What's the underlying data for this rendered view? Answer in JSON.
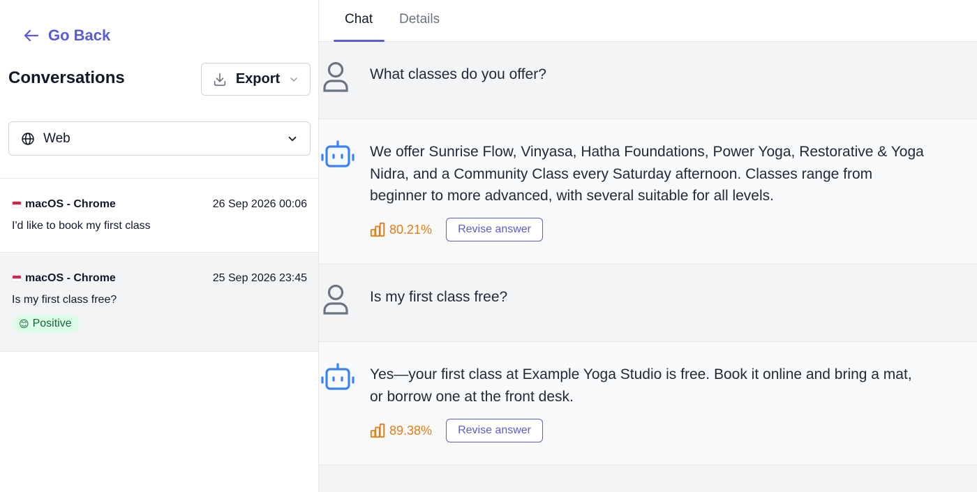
{
  "sidebar": {
    "go_back_label": "Go Back",
    "title": "Conversations",
    "export_label": "Export",
    "channel_filter": {
      "icon": "globe-icon",
      "selected": "Web"
    },
    "conversations": [
      {
        "device": "macOS - Chrome",
        "timestamp": "26 Sep 2026 00:06",
        "preview": "I'd like to book my first class"
      },
      {
        "device": "macOS - Chrome",
        "timestamp": "25 Sep 2026 23:45",
        "preview": "Is my first class free?",
        "sentiment": {
          "emoji": "😊",
          "label": "Positive"
        }
      }
    ]
  },
  "tabs": [
    {
      "label": "Chat",
      "active": true
    },
    {
      "label": "Details",
      "active": false
    }
  ],
  "messages": [
    {
      "role": "user",
      "text": "What classes do you offer?"
    },
    {
      "role": "bot",
      "text": "We offer Sunrise Flow, Vinyasa, Hatha Foundations, Power Yoga, Restorative & Yoga Nidra, and a Community Class every Saturday afternoon. Classes range from beginner to more advanced, with several suitable for all levels.",
      "score": "80.21%",
      "revise_label": "Revise answer"
    },
    {
      "role": "user",
      "text": "Is my first class free?"
    },
    {
      "role": "bot",
      "text": "Yes—your first class at Example Yoga Studio is free. Book it online and bring a mat, or borrow one at the front desk.",
      "score": "89.38%",
      "revise_label": "Revise answer"
    }
  ],
  "colors": {
    "accent": "#5b5bd6",
    "score": "#ea7a12",
    "bot_icon": "#3b82f6",
    "user_icon": "#6b7280",
    "positive_bg": "#dcfce7"
  }
}
